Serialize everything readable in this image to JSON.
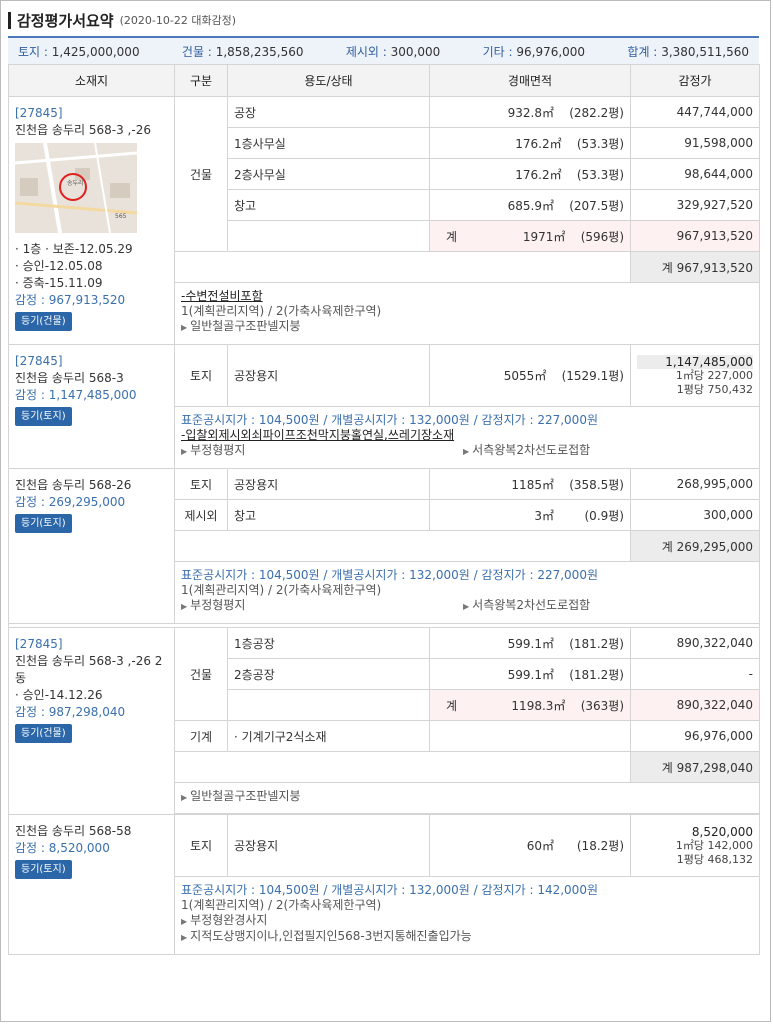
{
  "header": {
    "title": "감정평가서요약",
    "subtitle": "(2020-10-22  대화감정)"
  },
  "summary": [
    {
      "k": "토지 :",
      "v": "1,425,000,000"
    },
    {
      "k": "건물 :",
      "v": "1,858,235,560"
    },
    {
      "k": "제시외 :",
      "v": "300,000"
    },
    {
      "k": "기타 :",
      "v": "96,976,000"
    },
    {
      "k": "합계 :",
      "v": "3,380,511,560"
    }
  ],
  "columns": [
    "소재지",
    "구분",
    "용도/상태",
    "경매면적",
    "감정가"
  ],
  "p1": {
    "code": "[27845]",
    "addr": "진천읍 송두리 568-3 ,-26",
    "meta1": "· 1층  · 보존-12.05.29",
    "meta2": "· 승인-12.05.08",
    "meta3": "· 증축-15.11.09",
    "appraisal": "감정 : 967,913,520",
    "button": "등기(건물)",
    "kind": "건물",
    "rows": [
      {
        "use": "공장",
        "area": "932.8㎡",
        "py": "(282.2평)",
        "price": "447,744,000"
      },
      {
        "use": "1층사무실",
        "area": "176.2㎡",
        "py": "(53.3평)",
        "price": "91,598,000"
      },
      {
        "use": "2층사무실",
        "area": "176.2㎡",
        "py": "(53.3평)",
        "price": "98,644,000"
      },
      {
        "use": "창고",
        "area": "685.9㎡",
        "py": "(207.5평)",
        "price": "329,927,520"
      }
    ],
    "sub": {
      "label": "계",
      "area": "1971㎡",
      "py": "(596평)",
      "price": "967,913,520"
    },
    "total": "계 967,913,520",
    "note1": "-수변전설비포함",
    "note2": "1(계획관리지역) / 2(가축사육제한구역)",
    "note3": "일반철골구조판넬지붕"
  },
  "p2": {
    "code": "[27845]",
    "addr": "진천읍 송두리 568-3",
    "appraisal": "감정 : 1,147,485,000",
    "button": "등기(토지)",
    "kind": "토지",
    "use": "공장용지",
    "area": "5055㎡",
    "py": "(1529.1평)",
    "price": "1,147,485,000",
    "unit1": "1㎡당 227,000",
    "unit2": "1평당 750,432",
    "note1": "표준공시지가 : 104,500원 / 개별공시지가 : 132,000원 / 감정지가 : 227,000원",
    "note2": "-입찰외제시외쇠파이프조천막지붕홀연실,쓰레기장소재",
    "note3": "부정형평지",
    "note4": "서측왕복2차선도로접함"
  },
  "p3": {
    "addr": "진천읍 송두리 568-26",
    "appraisal": "감정 : 269,295,000",
    "button": "등기(토지)",
    "r1": {
      "kind": "토지",
      "use": "공장용지",
      "area": "1185㎡",
      "py": "(358.5평)",
      "price": "268,995,000"
    },
    "r2": {
      "kind": "제시외",
      "use": "창고",
      "area": "3㎡",
      "py": "(0.9평)",
      "price": "300,000"
    },
    "total": "계 269,295,000",
    "note1": "표준공시지가 : 104,500원 / 개별공시지가 : 132,000원 / 감정지가 : 227,000원",
    "note2": "1(계획관리지역) / 2(가축사육제한구역)",
    "note3": "부정형평지",
    "note4": "서측왕복2차선도로접함"
  },
  "p4": {
    "code": "[27845]",
    "addr": "진천읍 송두리 568-3 ,-26 2동",
    "meta": "· 승인-14.12.26",
    "appraisal": "감정 : 987,298,040",
    "button": "등기(건물)",
    "kind": "건물",
    "rows": [
      {
        "use": "1층공장",
        "area": "599.1㎡",
        "py": "(181.2평)",
        "price": "890,322,040"
      },
      {
        "use": "2층공장",
        "area": "599.1㎡",
        "py": "(181.2평)",
        "price": "-"
      }
    ],
    "sub": {
      "label": "계",
      "area": "1198.3㎡",
      "py": "(363평)",
      "price": "890,322,040"
    },
    "machine": {
      "kind": "기계",
      "use": "· 기계기구2식소재",
      "price": "96,976,000"
    },
    "total": "계 987,298,040",
    "note1": "일반철골구조판넬지붕"
  },
  "p5": {
    "addr": "진천읍 송두리 568-58",
    "appraisal": "감정 : 8,520,000",
    "button": "등기(토지)",
    "kind": "토지",
    "use": "공장용지",
    "area": "60㎡",
    "py": "(18.2평)",
    "price": "8,520,000",
    "unit1": "1㎡당 142,000",
    "unit2": "1평당 468,132",
    "note1": "표준공시지가 : 104,500원 / 개별공시지가 : 132,000원 / 감정지가 : 142,000원",
    "note2": "1(계획관리지역) / 2(가축사육제한구역)",
    "note3": "부정형완경사지",
    "note4": "지적도상맹지이나,인접필지인568-3번지통해진출입가능"
  },
  "map_labels": [
    "송두리",
    "565"
  ],
  "colors": {
    "accent": "#4a78b8",
    "button": "#2a66a8",
    "pink": "#fdf1f1"
  }
}
